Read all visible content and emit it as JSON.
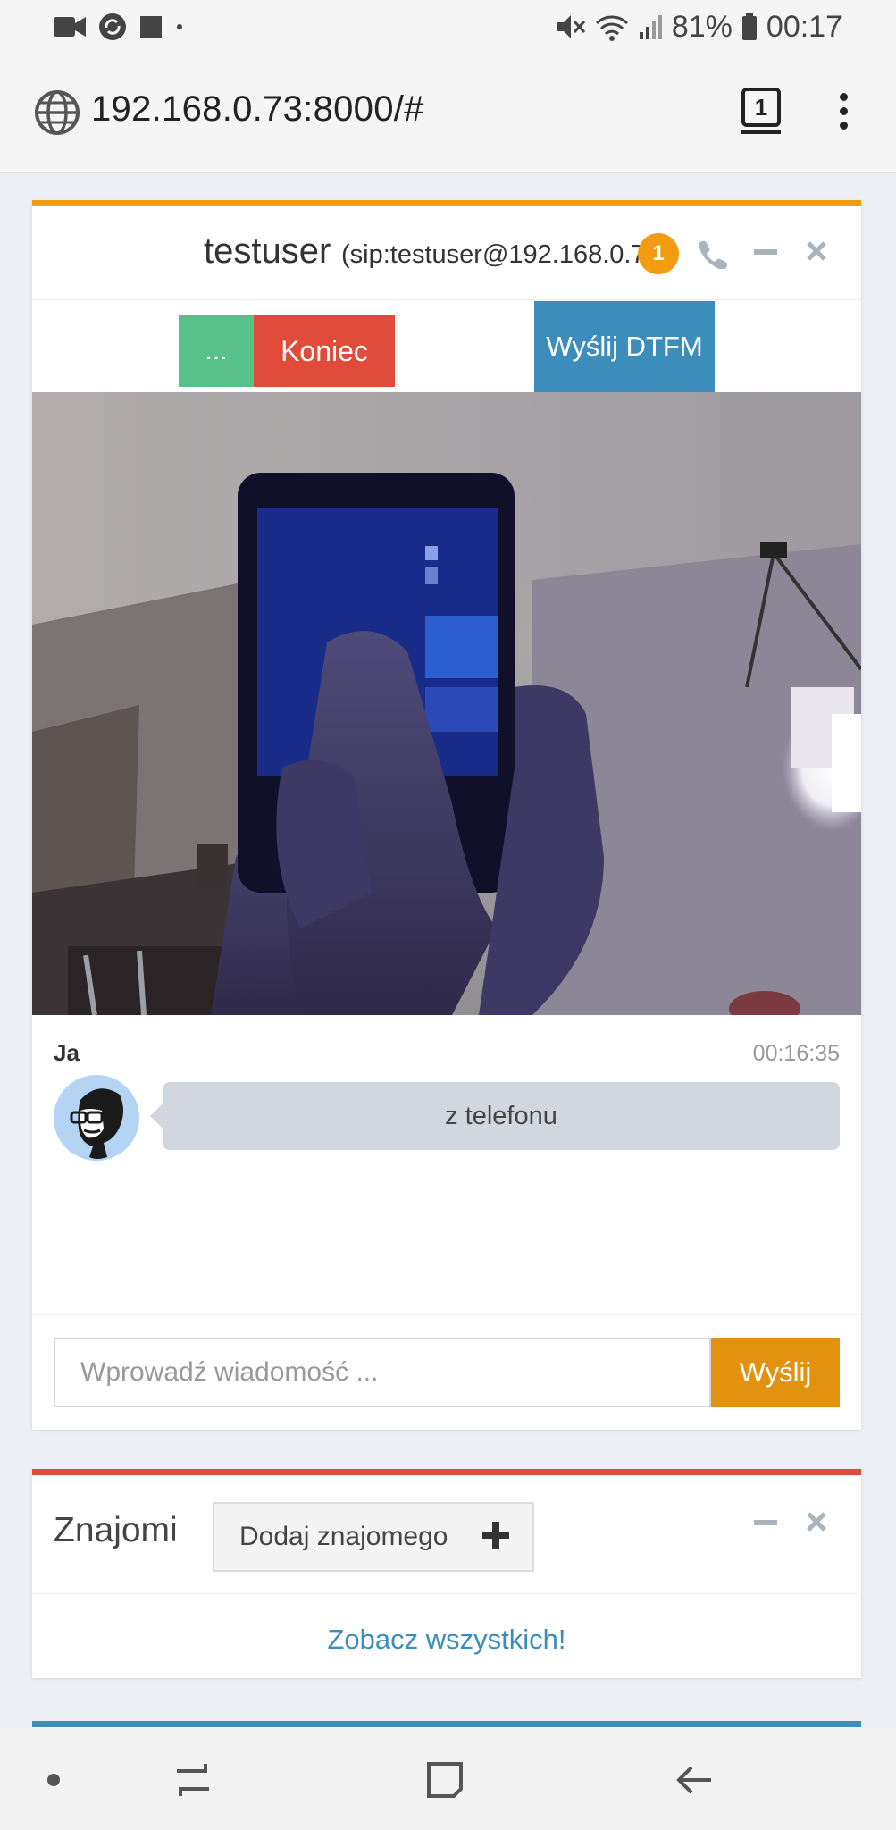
{
  "status_bar": {
    "battery_percent": "81%",
    "time": "00:17",
    "left_icons": [
      "video-camera-icon",
      "sync-icon",
      "stop-square-icon",
      "dot-icon"
    ],
    "right_icons": [
      "mute-icon",
      "wifi-icon",
      "signal-icon",
      "battery-icon"
    ]
  },
  "browser": {
    "url": "192.168.0.73:8000/#",
    "tab_count": "1"
  },
  "chat": {
    "contact_name": "testuser",
    "contact_sip": "(sip:testuser@192.168.0.73)",
    "badge_count": "1",
    "buttons": {
      "more_label": "...",
      "end_label": "Koniec",
      "dtmf_label": "Wyślij DTFM"
    },
    "messages": [
      {
        "sender": "Ja",
        "time": "00:16:35",
        "text": "z telefonu"
      }
    ],
    "input_placeholder": "Wprowadź wiadomość ...",
    "send_label": "Wyślij"
  },
  "friends": {
    "title": "Znajomi",
    "add_label": "Dodaj znajomego",
    "see_all_label": "Zobacz wszystkich!"
  },
  "colors": {
    "accent_orange": "#f39c12",
    "accent_red": "#dd4b39",
    "accent_blue": "#3c8dbc",
    "accent_green": "#58c08a"
  }
}
